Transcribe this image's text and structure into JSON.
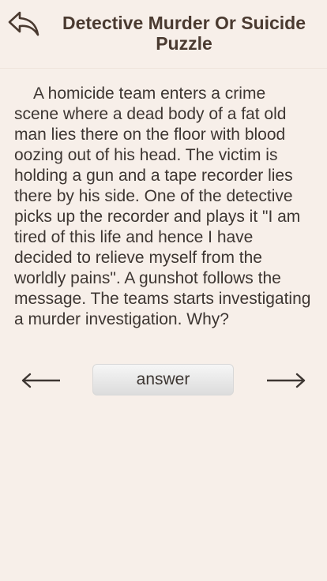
{
  "header": {
    "back_icon": "reply-arrow-icon",
    "title": "Detective Murder Or Suicide Puzzle"
  },
  "puzzle": {
    "text": "A homicide team enters a crime scene where a dead body of a fat old man lies there on the floor with blood oozing out of his head. The victim is holding a gun and a tape recorder lies there by his side. One of the detective picks up the recorder and plays it \"I am tired of this life and hence I have decided to relieve myself from the worldly pains\". A gunshot follows the message. The teams starts investigating a murder investigation. Why?"
  },
  "nav": {
    "prev_icon": "left-arrow-icon",
    "next_icon": "right-arrow-icon",
    "answer_label": "answer"
  },
  "colors": {
    "background": "#f7efe9",
    "text": "#3d3632",
    "title": "#4a3a30"
  }
}
